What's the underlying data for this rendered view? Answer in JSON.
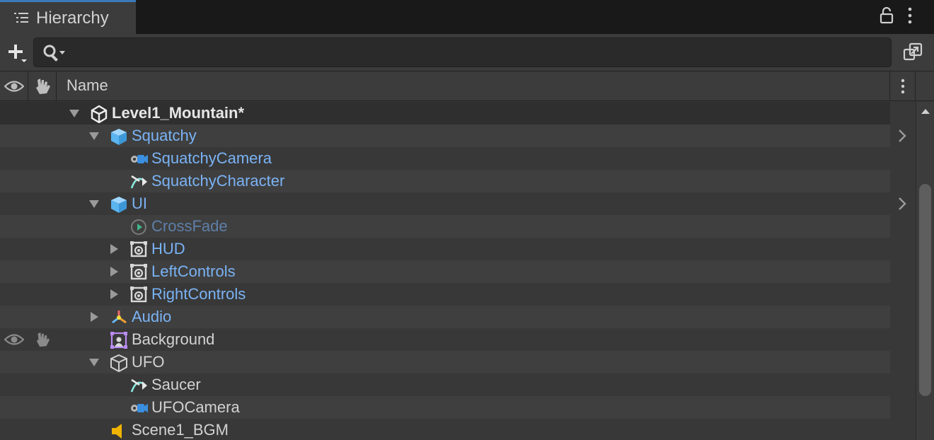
{
  "window": {
    "tab_label": "Hierarchy",
    "tab_icon": "list-icon",
    "lock_icon": "lock-icon",
    "menu_icon": "kebab-menu-icon"
  },
  "toolbar": {
    "add_icon": "plus-dropdown-icon",
    "search": {
      "value": "",
      "placeholder": "",
      "icon": "search-dropdown-icon"
    },
    "scene_link_icon": "open-scene-link-icon"
  },
  "header": {
    "visibility_icon": "eye-icon",
    "pickability_icon": "hand-icon",
    "name_label": "Name",
    "menu_icon": "kebab-menu-icon"
  },
  "colors": {
    "prefab_blue": "#7ab3f5",
    "inactive_blue": "#5f7fa8",
    "accent": "#3a79bb",
    "text": "#d2d2d2"
  },
  "tree": [
    {
      "label": "Level1_Mountain*",
      "depth": 0,
      "expanded": true,
      "icon": "unity-scene-icon",
      "style": "bold",
      "hasArrow": true
    },
    {
      "label": "Squatchy",
      "depth": 1,
      "expanded": true,
      "icon": "prefab-cube-icon",
      "style": "blue",
      "hasArrow": true,
      "prefabOverride": true
    },
    {
      "label": "SquatchyCamera",
      "depth": 2,
      "expanded": false,
      "icon": "cinemachine-camera-icon",
      "style": "blue",
      "hasArrow": false
    },
    {
      "label": "SquatchyCharacter",
      "depth": 2,
      "expanded": false,
      "icon": "spline-icon",
      "style": "blue",
      "hasArrow": false
    },
    {
      "label": "UI",
      "depth": 1,
      "expanded": true,
      "icon": "prefab-cube-icon",
      "style": "blue",
      "hasArrow": true,
      "prefabOverride": true
    },
    {
      "label": "CrossFade",
      "depth": 2,
      "expanded": false,
      "icon": "animation-play-icon",
      "style": "dim",
      "hasArrow": false
    },
    {
      "label": "HUD",
      "depth": 2,
      "expanded": false,
      "icon": "ui-document-icon",
      "style": "blue",
      "hasArrow": true
    },
    {
      "label": "LeftControls",
      "depth": 2,
      "expanded": false,
      "icon": "ui-document-icon",
      "style": "blue",
      "hasArrow": true
    },
    {
      "label": "RightControls",
      "depth": 2,
      "expanded": false,
      "icon": "ui-document-icon",
      "style": "blue",
      "hasArrow": true
    },
    {
      "label": "Audio",
      "depth": 1,
      "expanded": false,
      "icon": "audio-axis-icon",
      "style": "blue",
      "hasArrow": true
    },
    {
      "label": "Background",
      "depth": 1,
      "expanded": false,
      "icon": "sprite-shape-icon",
      "style": "plain",
      "hasArrow": false,
      "showVisibility": true
    },
    {
      "label": "UFO",
      "depth": 1,
      "expanded": true,
      "icon": "gameobject-cube-icon",
      "style": "plain",
      "hasArrow": true
    },
    {
      "label": "Saucer",
      "depth": 2,
      "expanded": false,
      "icon": "spline-icon",
      "style": "plain",
      "hasArrow": false
    },
    {
      "label": "UFOCamera",
      "depth": 2,
      "expanded": false,
      "icon": "cinemachine-camera-icon",
      "style": "plain",
      "hasArrow": false
    },
    {
      "label": "Scene1_BGM",
      "depth": 1,
      "expanded": false,
      "icon": "audio-source-icon",
      "style": "plain",
      "hasArrow": false
    }
  ]
}
